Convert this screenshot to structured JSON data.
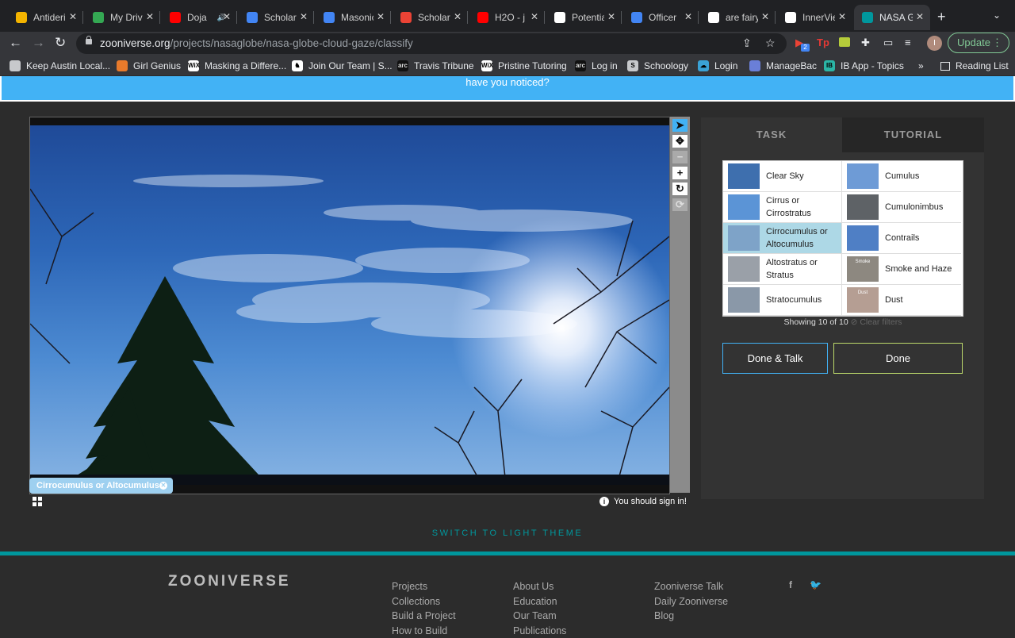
{
  "browser": {
    "tabs": [
      {
        "title": "Antideri",
        "icon": "slides-icon",
        "color": "#f4b400"
      },
      {
        "title": "My Drive",
        "icon": "drive-icon",
        "color": "#34a853"
      },
      {
        "title": "Doja",
        "icon": "youtube-icon",
        "color": "#ff0000",
        "audio": "🔊"
      },
      {
        "title": "Scholar",
        "icon": "docs-icon",
        "color": "#4285f4"
      },
      {
        "title": "Masonic",
        "icon": "docs-icon",
        "color": "#4285f4"
      },
      {
        "title": "Scholar",
        "icon": "gmail-icon",
        "color": "#ea4335"
      },
      {
        "title": "H2O - j",
        "icon": "youtube-icon",
        "color": "#ff0000"
      },
      {
        "title": "Potentia",
        "icon": "potential-icon",
        "color": "#ffffff"
      },
      {
        "title": "Officer",
        "icon": "docs-icon",
        "color": "#4285f4"
      },
      {
        "title": "are fairy",
        "icon": "google-icon",
        "color": "#ffffff"
      },
      {
        "title": "InnerVie",
        "icon": "innerview-icon",
        "color": "#ffffff"
      },
      {
        "title": "NASA G",
        "icon": "zooniverse-icon",
        "color": "#00979d"
      }
    ],
    "tab_close": "✕",
    "new_tab": "+",
    "url_host": "zooniverse.org",
    "url_path": "/projects/nasaglobe/nasa-globe-cloud-gaze/classify",
    "update_label": "Update",
    "profile_initial": "I",
    "ext_badge": "2",
    "bookmarks": [
      {
        "label": "Keep Austin Local...",
        "icon": "globe-icon",
        "mark": ""
      },
      {
        "label": "Girl Genius",
        "icon": "girl-genius-icon",
        "mark": ""
      },
      {
        "label": "Masking a Differe...",
        "icon": "wix-icon",
        "mark": "WiX"
      },
      {
        "label": "Join Our Team | S...",
        "icon": "bookmark-icon",
        "mark": "♞"
      },
      {
        "label": "Travis Tribune",
        "icon": "site-icon",
        "mark": "arc"
      },
      {
        "label": "Pristine Tutoring",
        "icon": "wix-icon",
        "mark": "WiX"
      },
      {
        "label": "Log in",
        "icon": "site-icon",
        "mark": "arc"
      },
      {
        "label": "Schoology",
        "icon": "schoology-icon",
        "mark": "S"
      },
      {
        "label": "Login",
        "icon": "cloud-icon",
        "mark": "☁"
      },
      {
        "label": "ManageBac",
        "icon": "managebac-icon",
        "mark": ""
      },
      {
        "label": "IB App - Topics",
        "icon": "ib-icon",
        "mark": "IB"
      }
    ],
    "bookmarks_more": "»",
    "reading_list": "Reading List"
  },
  "banner": {
    "text": "have you noticed?"
  },
  "viewer": {
    "annotation_label": "Cirrocumulus or Altocumulus",
    "sign_in": "You should sign in!"
  },
  "task_panel": {
    "tab_task": "TASK",
    "tab_tutorial": "TUTORIAL",
    "choices": [
      {
        "label": "Clear Sky",
        "selected": false,
        "thumb": "#3e6fae"
      },
      {
        "label": "Cumulus",
        "selected": false,
        "thumb": "#6e9bd6"
      },
      {
        "label": "Cirrus or Cirrostratus",
        "selected": false,
        "thumb": "#5b94d6"
      },
      {
        "label": "Cumulonimbus",
        "selected": false,
        "thumb": "#5e6266"
      },
      {
        "label": "Cirrocumulus or Altocumulus",
        "selected": true,
        "thumb": "#7ea3c8"
      },
      {
        "label": "Contrails",
        "selected": false,
        "thumb": "#4f7fc5"
      },
      {
        "label": "Altostratus or Stratus",
        "selected": false,
        "thumb": "#9aa0a8"
      },
      {
        "label": "Smoke and Haze",
        "selected": false,
        "thumb": "#8d8880",
        "mark": "Smoke"
      },
      {
        "label": "Stratocumulus",
        "selected": false,
        "thumb": "#8a98a8"
      },
      {
        "label": "Dust",
        "selected": false,
        "thumb": "#b59e93",
        "mark": "Dust"
      }
    ],
    "showing": "Showing 10 of 10",
    "clear_filters": "⊘ Clear filters",
    "done_talk": "Done & Talk",
    "done": "Done"
  },
  "switch_theme": "SWITCH TO LIGHT THEME",
  "footer": {
    "logo": "ZOONIVERSE",
    "col1": [
      "Projects",
      "Collections",
      "Build a Project",
      "How to Build"
    ],
    "col2": [
      "About Us",
      "Education",
      "Our Team",
      "Publications"
    ],
    "col3": [
      "Zooniverse Talk",
      "Daily Zooniverse",
      "Blog"
    ],
    "social": [
      "f",
      "🐦"
    ]
  },
  "colors": {
    "accent": "#00979d",
    "selected": "#add8e6",
    "done_talk_border": "#42b2f5",
    "done_border": "#bcd96b",
    "banner": "#42b2f5"
  }
}
